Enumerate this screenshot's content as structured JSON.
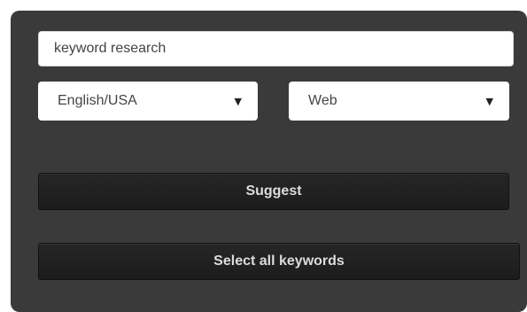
{
  "search": {
    "value": "keyword research"
  },
  "language_select": {
    "selected": "English/USA",
    "caret_icon": "caret-down-icon"
  },
  "type_select": {
    "selected": "Web",
    "caret_icon": "caret-down-icon"
  },
  "buttons": {
    "suggest_label": "Suggest",
    "select_all_label": "Select all keywords"
  },
  "colors": {
    "panel_background": "#3a3a3a",
    "button_background": "#222222",
    "button_text": "#dcdcdc",
    "field_background": "#ffffff"
  }
}
